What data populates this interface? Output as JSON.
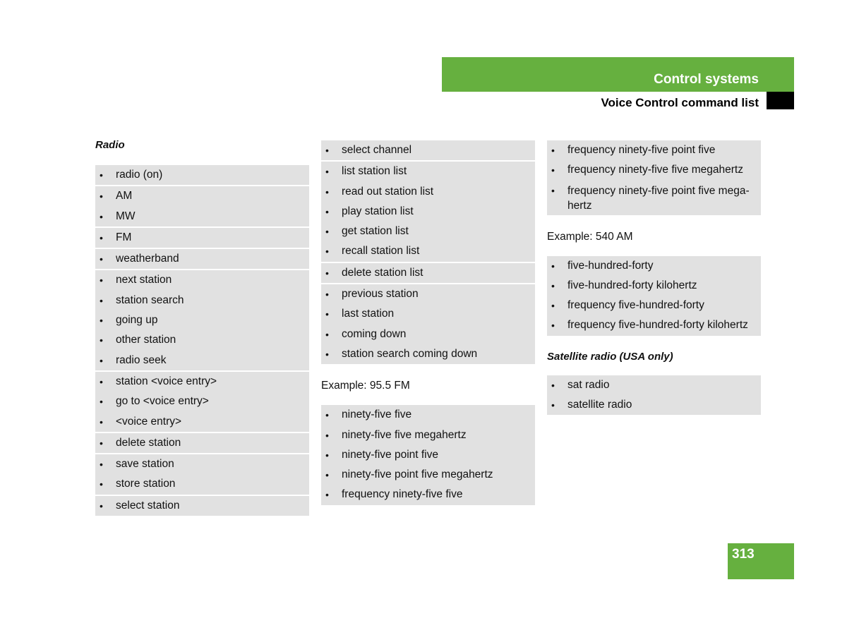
{
  "header": {
    "chapter": "Control systems",
    "section": "Voice Control command list",
    "accent_color": "#66b03f"
  },
  "page_number": "313",
  "columns": [
    {
      "title": "Radio",
      "groups": [
        [
          "radio (on)"
        ],
        [
          "AM",
          "MW"
        ],
        [
          "FM"
        ],
        [
          "weatherband"
        ],
        [
          "next station",
          "station search",
          "going up",
          "other station",
          "radio seek"
        ],
        [
          "station <voice entry>",
          "go to <voice entry>",
          "<voice entry>"
        ],
        [
          "delete station"
        ],
        [
          "save station",
          "store station"
        ],
        [
          "select station"
        ]
      ]
    },
    {
      "groups": [
        [
          "select channel"
        ],
        [
          "list station list",
          "read out station list",
          "play station list",
          "get station list",
          "recall station list"
        ],
        [
          "delete station list"
        ],
        [
          "previous station",
          "last station",
          "coming down",
          "station search coming down"
        ]
      ],
      "example": "Example: 95.5 FM",
      "example_groups": [
        [
          "ninety-five five",
          "ninety-five five megahertz",
          "ninety-five point five",
          "ninety-five point five megahertz",
          "frequency ninety-five five"
        ]
      ]
    },
    {
      "groups": [
        [
          "frequency ninety-five point five",
          "frequency ninety-five five megahertz",
          "frequency ninety-five point five mega-hertz"
        ]
      ],
      "example": "Example: 540 AM",
      "example_groups": [
        [
          "five-hundred-forty",
          "five-hundred-forty kilohertz",
          "frequency five-hundred-forty",
          "frequency five-hundred-forty kilohertz"
        ]
      ],
      "subsection_title": "Satellite radio (USA only)",
      "subsection_groups": [
        [
          "sat radio",
          "satellite radio"
        ]
      ]
    }
  ]
}
